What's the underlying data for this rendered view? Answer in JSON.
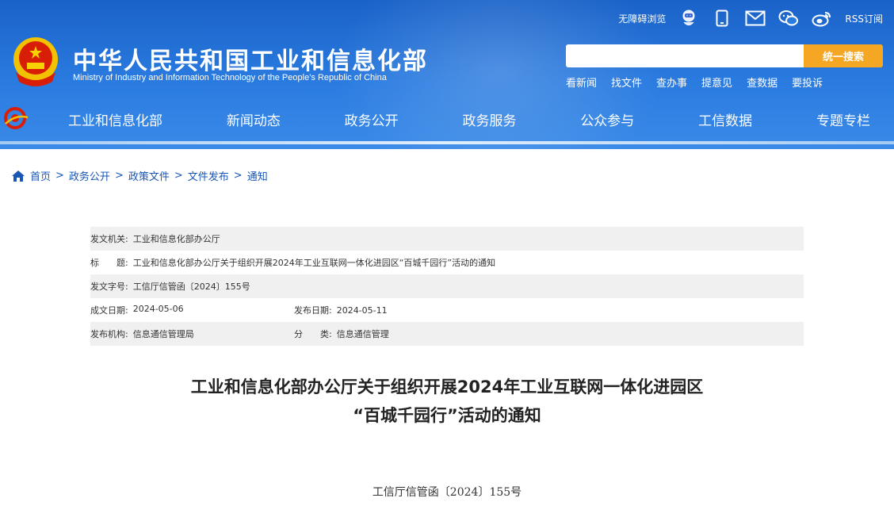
{
  "topbar": {
    "accessibility": "无障碍浏览",
    "rss": "RSS订阅",
    "icons": [
      "robot-assistant-icon",
      "mobile-icon",
      "mail-icon",
      "wechat-icon",
      "weibo-icon"
    ]
  },
  "site": {
    "title": "中华人民共和国工业和信息化部",
    "subtitle": "Ministry of Industry and Information Technology of the People’s Republic of China"
  },
  "search": {
    "placeholder": "",
    "button_label": "统一搜索"
  },
  "quicklinks": [
    "看新闻",
    "找文件",
    "查办事",
    "提意见",
    "查数据",
    "要投诉"
  ],
  "nav": [
    "工业和信息化部",
    "新闻动态",
    "政务公开",
    "政务服务",
    "公众参与",
    "工信数据",
    "专题专栏"
  ],
  "breadcrumb": [
    "首页",
    "政务公开",
    "政策文件",
    "文件发布",
    "通知"
  ],
  "breadcrumb_sep": ">",
  "meta": {
    "issuer_label": "发文机关:",
    "issuer": "工业和信息化部办公厅",
    "title_label": "标　　题:",
    "title": "工业和信息化部办公厅关于组织开展2024年工业互联网一体化进园区“百城千园行”活动的通知",
    "docno_label": "发文字号:",
    "docno": "工信厅信管函〔2024〕155号",
    "created_label": "成文日期:",
    "created": "2024-05-06",
    "published_label": "发布日期:",
    "published": "2024-05-11",
    "agency_label": "发布机构:",
    "agency": "信息通信管理局",
    "category_label": "分　　类:",
    "category": "信息通信管理"
  },
  "document": {
    "title_line1": "工业和信息化部办公厅关于组织开展2024年工业互联网一体化进园区",
    "title_line2": "“百城千园行”活动的通知",
    "number": "工信厅信管函〔2024〕155号"
  },
  "colors": {
    "header_blue": "#1a62c8",
    "search_button": "#f5a623",
    "link_blue": "#1a56b3"
  }
}
